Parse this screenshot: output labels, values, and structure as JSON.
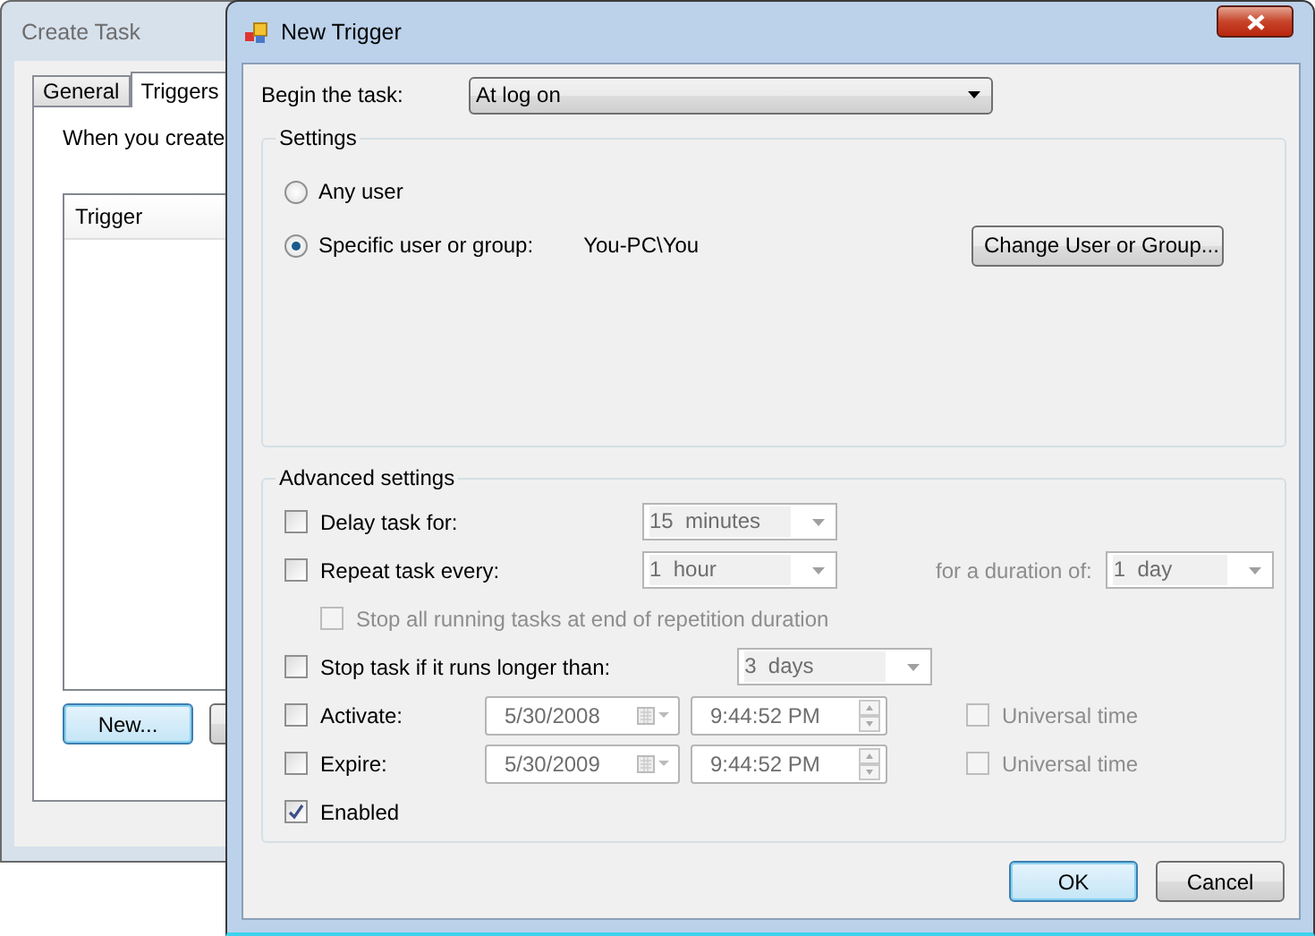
{
  "back_window": {
    "title": "Create Task",
    "tabs": [
      {
        "label": "General",
        "selected": false
      },
      {
        "label": "Triggers",
        "selected": true
      }
    ],
    "intro": "When you create",
    "list": {
      "columns": [
        "Trigger"
      ]
    },
    "buttons": [
      "New..."
    ]
  },
  "dialog": {
    "title": "New Trigger",
    "begin": {
      "label": "Begin the task:",
      "value": "At log on"
    },
    "settings": {
      "title": "Settings",
      "options": [
        {
          "label": "Any user",
          "selected": false
        },
        {
          "label": "Specific user or group:",
          "selected": true,
          "value": "You-PC\\You"
        }
      ],
      "change_button": "Change User or Group..."
    },
    "advanced": {
      "title": "Advanced settings",
      "rows": [
        {
          "kind": "combo",
          "label": "Delay task for:",
          "checked": false,
          "value": "15  minutes"
        },
        {
          "kind": "combo",
          "label": "Repeat task every:",
          "checked": false,
          "value": "1  hour",
          "extra": {
            "label": "for a duration of:",
            "value": "1  day"
          }
        },
        {
          "kind": "sub",
          "label": "Stop all running tasks at end of repetition duration",
          "checked": false,
          "disabled": true
        },
        {
          "kind": "combo",
          "label": "Stop task if it runs longer than:",
          "checked": false,
          "value": "3  days"
        },
        {
          "kind": "datetime",
          "label": "Activate:",
          "checked": false,
          "date": "5/30/2008",
          "time": "9:44:52 PM",
          "utc": {
            "label": "Universal time",
            "checked": false
          }
        },
        {
          "kind": "datetime",
          "label": "Expire:",
          "checked": false,
          "date": "5/30/2009",
          "time": "9:44:52 PM",
          "utc": {
            "label": "Universal time",
            "checked": false
          }
        },
        {
          "kind": "check",
          "label": "Enabled",
          "checked": true
        }
      ]
    },
    "buttons": [
      {
        "label": "OK",
        "default": true
      },
      {
        "label": "Cancel",
        "default": false
      }
    ]
  }
}
